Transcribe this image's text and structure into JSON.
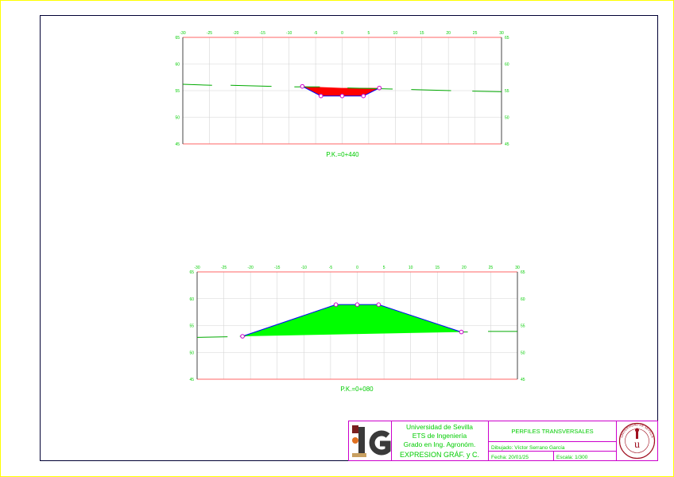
{
  "profiles": [
    {
      "label": "P.K.=0+440",
      "x_ticks": [
        -30,
        -25,
        -20,
        -15,
        -10,
        -5,
        0,
        5,
        10,
        15,
        20,
        25,
        30
      ],
      "y_ticks": [
        45,
        50,
        55,
        60,
        65
      ],
      "x_range": [
        -30,
        30
      ],
      "y_range": [
        45,
        65
      ],
      "terrain_segments": [
        [
          [
            -30,
            56.2
          ],
          [
            -24.5,
            56.0
          ]
        ],
        [
          [
            -21,
            56.0
          ],
          [
            -13.3,
            55.8
          ]
        ],
        [
          [
            -9,
            55.7
          ],
          [
            -4.2,
            55.7
          ]
        ],
        [
          [
            1,
            55.5
          ],
          [
            9.5,
            55.3
          ]
        ],
        [
          [
            13,
            55.2
          ],
          [
            20.5,
            55.0
          ]
        ],
        [
          [
            24.5,
            54.9
          ],
          [
            30,
            54.8
          ]
        ]
      ],
      "cut_fill_polygon": [
        [
          -7.5,
          55.8
        ],
        [
          -4,
          54
        ],
        [
          4,
          54
        ],
        [
          7,
          55.5
        ],
        [
          0,
          55.5
        ]
      ],
      "cut_fill_color": "#ff0000",
      "subgrade_line": [
        [
          -7.5,
          55.8
        ],
        [
          -4,
          54
        ],
        [
          4,
          54
        ],
        [
          7,
          55.5
        ]
      ],
      "control_points": [
        [
          -7.5,
          55.8
        ],
        [
          -4,
          54
        ],
        [
          0,
          54
        ],
        [
          4,
          54
        ],
        [
          7,
          55.5
        ]
      ]
    },
    {
      "label": "P.K.=0+080",
      "x_ticks": [
        -30,
        -25,
        -20,
        -15,
        -10,
        -5,
        0,
        5,
        10,
        15,
        20,
        25,
        30
      ],
      "y_ticks": [
        45,
        50,
        55,
        60,
        65
      ],
      "x_range": [
        -30,
        30
      ],
      "y_range": [
        45,
        65
      ],
      "terrain_segments": [
        [
          [
            -30,
            52.8
          ],
          [
            -24.3,
            52.9
          ]
        ],
        [
          [
            -22,
            53.0
          ],
          [
            -21,
            53.0
          ]
        ],
        [
          [
            19.5,
            53.8
          ],
          [
            20.7,
            53.8
          ]
        ],
        [
          [
            24.5,
            53.9
          ],
          [
            30,
            53.9
          ]
        ]
      ],
      "cut_fill_polygon": [
        [
          -21.5,
          53
        ],
        [
          -4,
          58.9
        ],
        [
          4,
          58.9
        ],
        [
          19.5,
          53.8
        ]
      ],
      "cut_fill_color": "#00ff00",
      "subgrade_line": [
        [
          -21.5,
          53
        ],
        [
          -4,
          58.9
        ],
        [
          4,
          58.9
        ],
        [
          19.5,
          53.8
        ]
      ],
      "control_points": [
        [
          -21.5,
          53
        ],
        [
          -4,
          58.9
        ],
        [
          0,
          58.9
        ],
        [
          4,
          58.9
        ],
        [
          19.5,
          53.8
        ]
      ]
    }
  ],
  "title_block": {
    "university": "Universidad de Sevilla",
    "school": "ETS de Ingeniería",
    "degree": "Grado en Ing. Agronóm.",
    "subject": "EXPRESION GRÁF. y C.",
    "drawing_title": "PERFILES TRANSVERSALES",
    "drawn_by": "Dibujado: Víctor Serrano García",
    "date": "Fecha: 20/01/25",
    "scale": "Escala: 1/300",
    "logo_text": "UNIVERSIDAD DE SEVILLA"
  },
  "colors": {
    "sheet_border": "#ffff00",
    "frame": "#000033",
    "grid_axis": "#ff6666",
    "grid_line": "#d6d6d6",
    "terrain": "#00aa00",
    "tick_label": "#00cc00",
    "subgrade": "#0000ff",
    "point_ring": "#cc00cc",
    "title_border": "#cc00cc",
    "title_text": "#00cc00"
  }
}
